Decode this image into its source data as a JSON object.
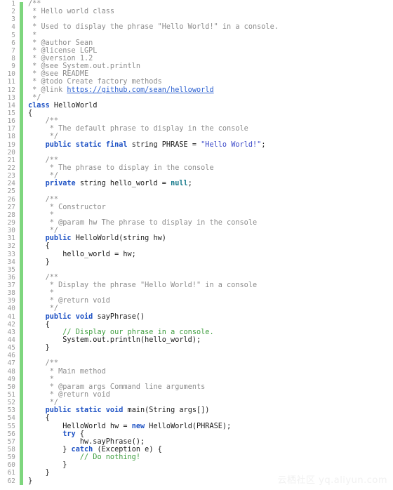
{
  "editor": {
    "language": "java",
    "first_line": 1,
    "last_line": 62,
    "total_lines": 62,
    "colors": {
      "background": "#ffffff",
      "text": "#1a1a1a",
      "line_number": "#999999",
      "change_marker": "#7ed67e",
      "keyword": "#1d51c4",
      "javadoc_comment": "#8c8c8c",
      "line_comment": "#3f9e3f",
      "string": "#3b49c9",
      "null_literal": "#177a8c",
      "link": "#2a5fd0",
      "watermark": "#f1f1f1"
    }
  },
  "watermark": {
    "text": "云栖社区 yq.aliyun.com"
  },
  "lines": [
    {
      "n": 1,
      "tokens": [
        {
          "c": "doc",
          "t": "/**"
        }
      ]
    },
    {
      "n": 2,
      "tokens": [
        {
          "c": "doc",
          "t": " * Hello world class"
        }
      ]
    },
    {
      "n": 3,
      "tokens": [
        {
          "c": "doc",
          "t": " *"
        }
      ]
    },
    {
      "n": 4,
      "tokens": [
        {
          "c": "doc",
          "t": " * Used to display the phrase \"Hello World!\" in a console."
        }
      ]
    },
    {
      "n": 5,
      "tokens": [
        {
          "c": "doc",
          "t": " *"
        }
      ]
    },
    {
      "n": 6,
      "tokens": [
        {
          "c": "doc",
          "t": " * @author Sean"
        }
      ]
    },
    {
      "n": 7,
      "tokens": [
        {
          "c": "doc",
          "t": " * @license LGPL"
        }
      ]
    },
    {
      "n": 8,
      "tokens": [
        {
          "c": "doc",
          "t": " * @version 1.2"
        }
      ]
    },
    {
      "n": 9,
      "tokens": [
        {
          "c": "doc",
          "t": " * @see System.out.println"
        }
      ]
    },
    {
      "n": 10,
      "tokens": [
        {
          "c": "doc",
          "t": " * @see README"
        }
      ]
    },
    {
      "n": 11,
      "tokens": [
        {
          "c": "doc",
          "t": " * @todo Create factory methods"
        }
      ]
    },
    {
      "n": 12,
      "tokens": [
        {
          "c": "doc",
          "t": " * @link "
        },
        {
          "c": "link",
          "t": "https://github.com/sean/helloworld"
        }
      ]
    },
    {
      "n": 13,
      "tokens": [
        {
          "c": "doc",
          "t": " */"
        }
      ]
    },
    {
      "n": 14,
      "tokens": [
        {
          "c": "kw",
          "t": "class"
        },
        {
          "c": "plain",
          "t": " HelloWorld"
        }
      ]
    },
    {
      "n": 15,
      "tokens": [
        {
          "c": "plain",
          "t": "{"
        }
      ]
    },
    {
      "n": 16,
      "tokens": [
        {
          "c": "doc",
          "t": "    /**"
        }
      ]
    },
    {
      "n": 17,
      "tokens": [
        {
          "c": "doc",
          "t": "     * The default phrase to display in the console"
        }
      ]
    },
    {
      "n": 18,
      "tokens": [
        {
          "c": "doc",
          "t": "     */"
        }
      ]
    },
    {
      "n": 19,
      "tokens": [
        {
          "c": "plain",
          "t": "    "
        },
        {
          "c": "kw",
          "t": "public static final"
        },
        {
          "c": "plain",
          "t": " string PHRASE = "
        },
        {
          "c": "string",
          "t": "\"Hello World!\""
        },
        {
          "c": "plain",
          "t": ";"
        }
      ]
    },
    {
      "n": 20,
      "tokens": [
        {
          "c": "plain",
          "t": ""
        }
      ]
    },
    {
      "n": 21,
      "tokens": [
        {
          "c": "doc",
          "t": "    /**"
        }
      ]
    },
    {
      "n": 22,
      "tokens": [
        {
          "c": "doc",
          "t": "     * The phrase to display in the console"
        }
      ]
    },
    {
      "n": 23,
      "tokens": [
        {
          "c": "doc",
          "t": "     */"
        }
      ]
    },
    {
      "n": 24,
      "tokens": [
        {
          "c": "plain",
          "t": "    "
        },
        {
          "c": "kw",
          "t": "private"
        },
        {
          "c": "plain",
          "t": " string hello_world = "
        },
        {
          "c": "null",
          "t": "null"
        },
        {
          "c": "plain",
          "t": ";"
        }
      ]
    },
    {
      "n": 25,
      "tokens": [
        {
          "c": "plain",
          "t": ""
        }
      ]
    },
    {
      "n": 26,
      "tokens": [
        {
          "c": "doc",
          "t": "    /**"
        }
      ]
    },
    {
      "n": 27,
      "tokens": [
        {
          "c": "doc",
          "t": "     * Constructor"
        }
      ]
    },
    {
      "n": 28,
      "tokens": [
        {
          "c": "doc",
          "t": "     *"
        }
      ]
    },
    {
      "n": 29,
      "tokens": [
        {
          "c": "doc",
          "t": "     * @param hw The phrase to display in the console"
        }
      ]
    },
    {
      "n": 30,
      "tokens": [
        {
          "c": "doc",
          "t": "     */"
        }
      ]
    },
    {
      "n": 31,
      "tokens": [
        {
          "c": "plain",
          "t": "    "
        },
        {
          "c": "kw",
          "t": "public"
        },
        {
          "c": "plain",
          "t": " HelloWorld(string hw)"
        }
      ]
    },
    {
      "n": 32,
      "tokens": [
        {
          "c": "plain",
          "t": "    {"
        }
      ]
    },
    {
      "n": 33,
      "tokens": [
        {
          "c": "plain",
          "t": "        hello_world = hw;"
        }
      ]
    },
    {
      "n": 34,
      "tokens": [
        {
          "c": "plain",
          "t": "    }"
        }
      ]
    },
    {
      "n": 35,
      "tokens": [
        {
          "c": "plain",
          "t": ""
        }
      ]
    },
    {
      "n": 36,
      "tokens": [
        {
          "c": "doc",
          "t": "    /**"
        }
      ]
    },
    {
      "n": 37,
      "tokens": [
        {
          "c": "doc",
          "t": "     * Display the phrase \"Hello World!\" in a console"
        }
      ]
    },
    {
      "n": 38,
      "tokens": [
        {
          "c": "doc",
          "t": "     *"
        }
      ]
    },
    {
      "n": 39,
      "tokens": [
        {
          "c": "doc",
          "t": "     * @return void"
        }
      ]
    },
    {
      "n": 40,
      "tokens": [
        {
          "c": "doc",
          "t": "     */"
        }
      ]
    },
    {
      "n": 41,
      "tokens": [
        {
          "c": "plain",
          "t": "    "
        },
        {
          "c": "kw",
          "t": "public void"
        },
        {
          "c": "plain",
          "t": " sayPhrase()"
        }
      ]
    },
    {
      "n": 42,
      "tokens": [
        {
          "c": "plain",
          "t": "    {"
        }
      ]
    },
    {
      "n": 43,
      "tokens": [
        {
          "c": "plain",
          "t": "        "
        },
        {
          "c": "comment",
          "t": "// Display our phrase in a console."
        }
      ]
    },
    {
      "n": 44,
      "tokens": [
        {
          "c": "plain",
          "t": "        System.out.println(hello_world);"
        }
      ]
    },
    {
      "n": 45,
      "tokens": [
        {
          "c": "plain",
          "t": "    }"
        }
      ]
    },
    {
      "n": 46,
      "tokens": [
        {
          "c": "plain",
          "t": ""
        }
      ]
    },
    {
      "n": 47,
      "tokens": [
        {
          "c": "doc",
          "t": "    /**"
        }
      ]
    },
    {
      "n": 48,
      "tokens": [
        {
          "c": "doc",
          "t": "     * Main method"
        }
      ]
    },
    {
      "n": 49,
      "tokens": [
        {
          "c": "doc",
          "t": "     *"
        }
      ]
    },
    {
      "n": 50,
      "tokens": [
        {
          "c": "doc",
          "t": "     * @param args Command line arguments"
        }
      ]
    },
    {
      "n": 51,
      "tokens": [
        {
          "c": "doc",
          "t": "     * @return void"
        }
      ]
    },
    {
      "n": 52,
      "tokens": [
        {
          "c": "doc",
          "t": "     */"
        }
      ]
    },
    {
      "n": 53,
      "tokens": [
        {
          "c": "plain",
          "t": "    "
        },
        {
          "c": "kw",
          "t": "public static void"
        },
        {
          "c": "plain",
          "t": " main(String args[])"
        }
      ]
    },
    {
      "n": 54,
      "tokens": [
        {
          "c": "plain",
          "t": "    {"
        }
      ]
    },
    {
      "n": 55,
      "tokens": [
        {
          "c": "plain",
          "t": "        HelloWorld hw = "
        },
        {
          "c": "kw",
          "t": "new"
        },
        {
          "c": "plain",
          "t": " HelloWorld(PHRASE);"
        }
      ]
    },
    {
      "n": 56,
      "tokens": [
        {
          "c": "plain",
          "t": "        "
        },
        {
          "c": "kw",
          "t": "try"
        },
        {
          "c": "plain",
          "t": " {"
        }
      ]
    },
    {
      "n": 57,
      "tokens": [
        {
          "c": "plain",
          "t": "            hw.sayPhrase();"
        }
      ]
    },
    {
      "n": 58,
      "tokens": [
        {
          "c": "plain",
          "t": "        } "
        },
        {
          "c": "kw",
          "t": "catch"
        },
        {
          "c": "plain",
          "t": " (Exception e) {"
        }
      ]
    },
    {
      "n": 59,
      "tokens": [
        {
          "c": "plain",
          "t": "            "
        },
        {
          "c": "comment",
          "t": "// Do nothing!"
        }
      ]
    },
    {
      "n": 60,
      "tokens": [
        {
          "c": "plain",
          "t": "        }"
        }
      ]
    },
    {
      "n": 61,
      "tokens": [
        {
          "c": "plain",
          "t": "    }"
        }
      ]
    },
    {
      "n": 62,
      "tokens": [
        {
          "c": "plain",
          "t": "}"
        }
      ]
    }
  ]
}
